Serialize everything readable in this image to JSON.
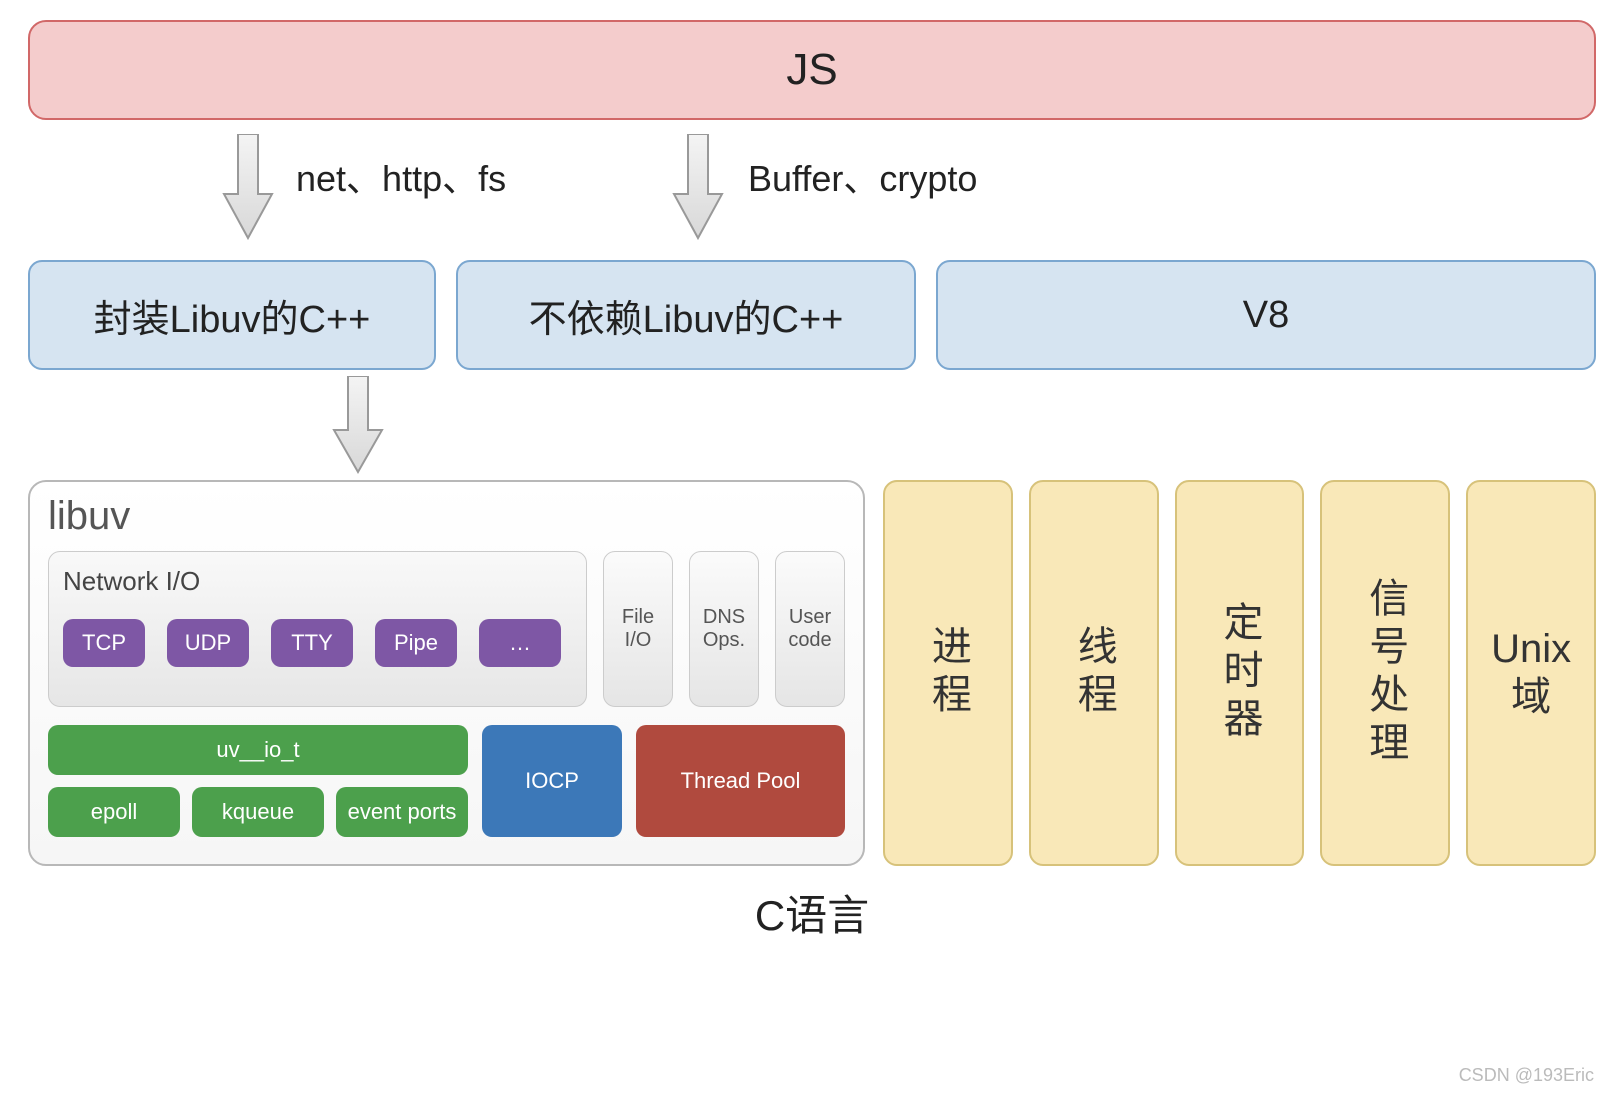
{
  "top": {
    "js": "JS"
  },
  "arrow_labels": {
    "left": "net、http、fs",
    "right": "Buffer、crypto"
  },
  "middle": {
    "libuv_cpp": "封装Libuv的C++",
    "nonlibuv_cpp": "不依赖Libuv的C++",
    "v8": "V8"
  },
  "libuv": {
    "title": "libuv",
    "network_io": {
      "title": "Network I/O",
      "protocols": [
        "TCP",
        "UDP",
        "TTY",
        "Pipe",
        "…"
      ]
    },
    "small_boxes": [
      "File I/O",
      "DNS Ops.",
      "User code"
    ],
    "green": {
      "uv_io_t": "uv__io_t",
      "impls": [
        "epoll",
        "kqueue",
        "event ports"
      ]
    },
    "iocp": "IOCP",
    "thread_pool": "Thread Pool"
  },
  "vertical_columns": [
    "进程",
    "线程",
    "定时器",
    "信号处理",
    "Unix 域"
  ],
  "bottom_label": "C语言",
  "watermark": "CSDN @193Eric"
}
